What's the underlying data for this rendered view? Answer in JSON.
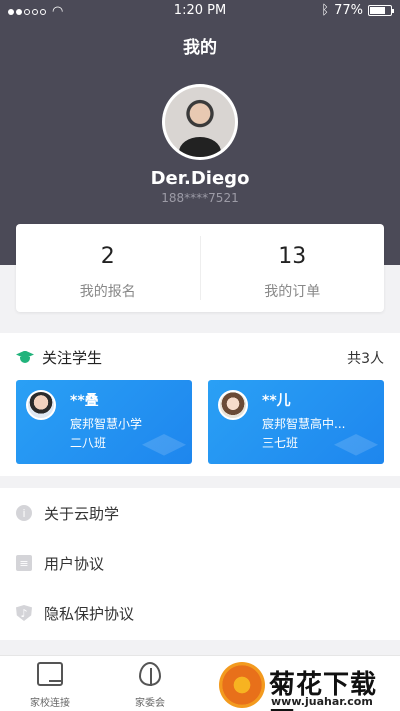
{
  "status_bar": {
    "time": "1:20 PM",
    "battery": "77%",
    "battery_level": 0.77
  },
  "header": {
    "title": "我的"
  },
  "profile": {
    "name": "Der.Diego",
    "phone": "188****7521"
  },
  "stats": [
    {
      "value": "2",
      "label": "我的报名"
    },
    {
      "value": "13",
      "label": "我的订单"
    }
  ],
  "students": {
    "title": "关注学生",
    "count": "共3人",
    "items": [
      {
        "name": "**叠",
        "school": "宸邦智慧小学",
        "class": "二八班"
      },
      {
        "name": "**儿",
        "school": "宸邦智慧高中...",
        "class": "三七班"
      }
    ]
  },
  "menu": {
    "items": [
      {
        "label": "关于云助学",
        "icon": "info-icon"
      },
      {
        "label": "用户协议",
        "icon": "document-icon"
      },
      {
        "label": "隐私保护协议",
        "icon": "shield-icon"
      }
    ]
  },
  "tabbar": {
    "items": [
      {
        "label": "家校连接",
        "icon": "phone-tab-icon"
      },
      {
        "label": "家委会",
        "icon": "leaf-tab-icon"
      }
    ]
  },
  "watermark": {
    "title": "菊花下载网",
    "url": "www.juahar.com"
  },
  "colors": {
    "header_bg": "#4b4a57",
    "accent_blue": "#1e86ee",
    "accent_green": "#21b37b"
  }
}
